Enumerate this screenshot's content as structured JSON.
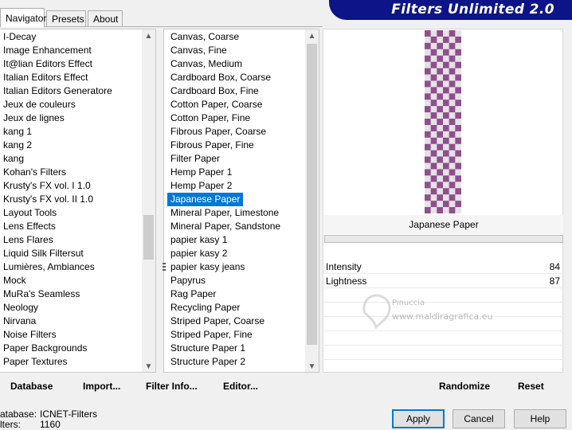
{
  "tabs": [
    "Navigator",
    "Presets",
    "About"
  ],
  "title": "Filters Unlimited 2.0",
  "categories": [
    "I-Decay",
    "Image Enhancement",
    "It@lian Editors Effect",
    "Italian Editors Effect",
    "Italian Editors Generatore",
    "Jeux de couleurs",
    "Jeux de lignes",
    "kang 1",
    "kang 2",
    "kang",
    "Kohan's Filters",
    "Krusty's FX vol. I 1.0",
    "Krusty's FX vol. II 1.0",
    "Layout Tools",
    "Lens Effects",
    "Lens Flares",
    "Liquid Silk Filtersut",
    "Lumières, Ambiances",
    "Mock",
    "MuRa's Seamless",
    "Neology",
    "Nirvana",
    "Noise Filters",
    "Paper Backgrounds",
    "Paper Textures"
  ],
  "filters": [
    "Canvas, Coarse",
    "Canvas, Fine",
    "Canvas, Medium",
    "Cardboard Box, Coarse",
    "Cardboard Box, Fine",
    "Cotton Paper, Coarse",
    "Cotton Paper, Fine",
    "Fibrous Paper, Coarse",
    "Fibrous Paper, Fine",
    "Filter Paper",
    "Hemp Paper 1",
    "Hemp Paper 2",
    "Japanese Paper",
    "Mineral Paper, Limestone",
    "Mineral Paper, Sandstone",
    "papier kasy 1",
    "papier kasy 2",
    "papier kasy jeans",
    "Papyrus",
    "Rag Paper",
    "Recycling Paper",
    "Striped Paper, Coarse",
    "Striped Paper, Fine",
    "Structure Paper 1",
    "Structure Paper 2"
  ],
  "selected_filter_index": 12,
  "preview_label": "Japanese Paper",
  "params": [
    {
      "name": "Intensity",
      "value": "84"
    },
    {
      "name": "Lightness",
      "value": "87"
    }
  ],
  "buttons": {
    "database": "Database",
    "import": "Import...",
    "filter_info": "Filter Info...",
    "editor": "Editor...",
    "randomize": "Randomize",
    "reset": "Reset",
    "apply": "Apply",
    "cancel": "Cancel",
    "help": "Help"
  },
  "status": {
    "database_label": "atabase:",
    "database_value": "ICNET-Filters",
    "filters_label": "lters:",
    "filters_value": "1160"
  },
  "watermark": {
    "line1": "Pinuccia",
    "line2": "www.maldiragrafica.eu"
  },
  "colors": {
    "title_bg": "#0d1487",
    "selection": "#0078d7",
    "checker_purple": "#8e4f8d",
    "checker_light": "#e6e2e6"
  }
}
